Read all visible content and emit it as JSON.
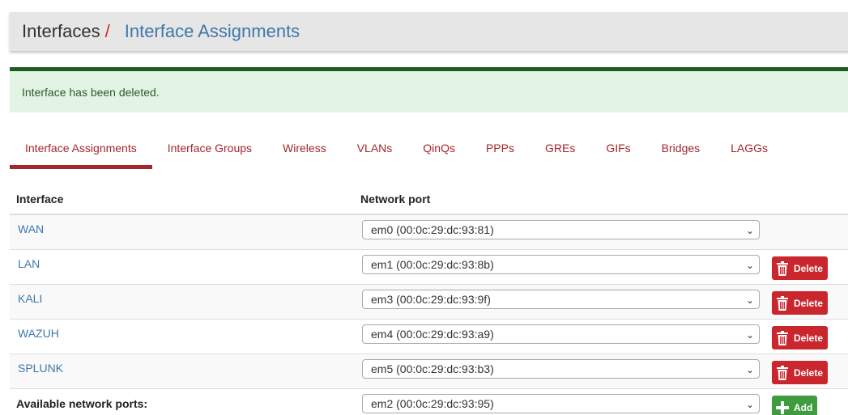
{
  "breadcrumb": {
    "root": "Interfaces",
    "separator": "/",
    "current": "Interface Assignments"
  },
  "alert": {
    "message": "Interface has been deleted."
  },
  "tabs": [
    {
      "label": "Interface Assignments",
      "active": true
    },
    {
      "label": "Interface Groups"
    },
    {
      "label": "Wireless"
    },
    {
      "label": "VLANs"
    },
    {
      "label": "QinQs"
    },
    {
      "label": "PPPs"
    },
    {
      "label": "GREs"
    },
    {
      "label": "GIFs"
    },
    {
      "label": "Bridges"
    },
    {
      "label": "LAGGs"
    }
  ],
  "table": {
    "columns": {
      "interface": "Interface",
      "network_port": "Network port"
    },
    "rows": [
      {
        "interface": "WAN",
        "port": "em0 (00:0c:29:dc:93:81)"
      },
      {
        "interface": "LAN",
        "port": "em1 (00:0c:29:dc:93:8b)",
        "action": "Delete"
      },
      {
        "interface": "KALI",
        "port": "em3 (00:0c:29:dc:93:9f)",
        "action": "Delete"
      },
      {
        "interface": "WAZUH",
        "port": "em4 (00:0c:29:dc:93:a9)",
        "action": "Delete"
      },
      {
        "interface": "SPLUNK",
        "port": "em5 (00:0c:29:dc:93:b3)",
        "action": "Delete"
      }
    ],
    "available": {
      "label": "Available network ports:",
      "port": "em2 (00:0c:29:dc:93:95)",
      "action": "Add"
    }
  },
  "colors": {
    "accent_red": "#a4262c",
    "link_blue": "#3f77ad",
    "success_green": "#3e9c3f",
    "danger_red": "#c9262d"
  },
  "icons": {
    "delete": "trash-icon",
    "add": "plus-icon",
    "select": "chevron-down-icon"
  }
}
